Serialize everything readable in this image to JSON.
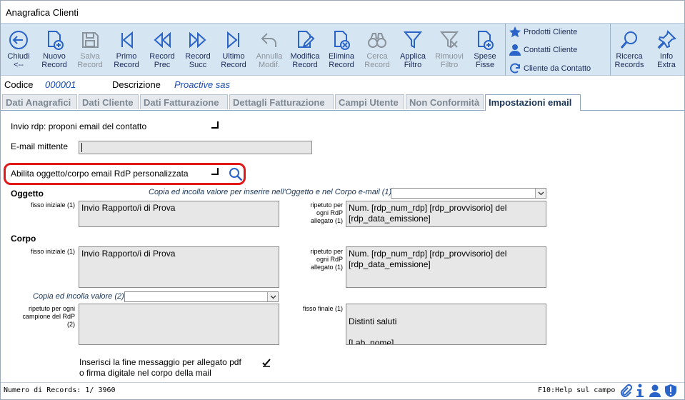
{
  "window": {
    "title": "Anagrafica Clienti"
  },
  "toolbar": {
    "buttons": [
      {
        "line1": "Chiudi",
        "line2": "<--",
        "icon": "close-arrow-icon",
        "enabled": true
      },
      {
        "line1": "Nuovo",
        "line2": "Record",
        "icon": "new-record-icon",
        "enabled": true
      },
      {
        "line1": "Salva",
        "line2": "Record",
        "icon": "save-icon",
        "enabled": false
      },
      {
        "line1": "Primo",
        "line2": "Record",
        "icon": "first-record-icon",
        "enabled": true
      },
      {
        "line1": "Record",
        "line2": "Prec",
        "icon": "previous-record-icon",
        "enabled": true
      },
      {
        "line1": "Record",
        "line2": "Succ",
        "icon": "next-record-icon",
        "enabled": true
      },
      {
        "line1": "Ultimo",
        "line2": "Record",
        "icon": "last-record-icon",
        "enabled": true
      },
      {
        "line1": "Annulla",
        "line2": "Modif.",
        "icon": "undo-icon",
        "enabled": false
      },
      {
        "line1": "Modifica",
        "line2": "Record",
        "icon": "edit-record-icon",
        "enabled": true
      },
      {
        "line1": "Elimina",
        "line2": "Record",
        "icon": "delete-record-icon",
        "enabled": true
      },
      {
        "line1": "Cerca",
        "line2": "Record",
        "icon": "binoculars-icon",
        "enabled": false
      },
      {
        "line1": "Applica",
        "line2": "Filtro",
        "icon": "filter-icon",
        "enabled": true
      },
      {
        "line1": "Rimuovi",
        "line2": "Filtro",
        "icon": "remove-filter-icon",
        "enabled": false
      },
      {
        "line1": "Spese",
        "line2": "Fisse",
        "icon": "fixed-costs-icon",
        "enabled": true
      }
    ],
    "side_links": [
      {
        "label": "Prodotti Cliente",
        "icon": "star-icon"
      },
      {
        "label": "Contatti Cliente",
        "icon": "contacts-icon"
      },
      {
        "label": "Cliente da Contatto",
        "icon": "refresh-icon"
      }
    ],
    "right_buttons": [
      {
        "line1": "Ricerca",
        "line2": "Records",
        "icon": "search-icon"
      },
      {
        "line1": "Info",
        "line2": "Extra",
        "icon": "pin-icon"
      }
    ]
  },
  "header": {
    "codice_label": "Codice",
    "codice_value": "000001",
    "descrizione_label": "Descrizione",
    "descrizione_value": "Proactive sas"
  },
  "tabs": [
    {
      "label": "Dati Anagrafici",
      "active": false
    },
    {
      "label": "Dati Cliente",
      "active": false
    },
    {
      "label": "Dati Fatturazione",
      "active": false
    },
    {
      "label": "Dettagli Fatturazione",
      "active": false
    },
    {
      "label": "Campi Utente",
      "active": false
    },
    {
      "label": "Non Conformità",
      "active": false
    },
    {
      "label": "Impostazioni email",
      "active": true
    }
  ],
  "form": {
    "invio_rdp_label": "Invio rdp: proponi email del contatto",
    "email_mittente_label": "E-mail mittente",
    "email_mittente_value": "",
    "abilita_label": "Abilita oggetto/corpo email RdP personalizzata",
    "oggetto_label": "Oggetto",
    "copia_oggetto_label": "Copia ed incolla valore per inserire nell'Oggetto e nel Corpo e-mail (1)",
    "copia_oggetto_value": "",
    "oggetto_fisso_label": "fisso iniziale (1)",
    "oggetto_fisso_value": "Invio Rapporto/i di Prova",
    "oggetto_ripetuto_label": "ripetuto per ogni RdP allegato (1)",
    "oggetto_ripetuto_value": "Num. [rdp_num_rdp] [rdp_provvisorio] del [rdp_data_emissione]",
    "corpo_label": "Corpo",
    "corpo_fisso_label": "fisso iniziale (1)",
    "corpo_fisso_value": "Invio Rapporto/i di Prova",
    "corpo_ripetuto_label": "ripetuto per ogni RdP allegato (1)",
    "corpo_ripetuto_value": "Num. [rdp_num_rdp] [rdp_provvisorio] del [rdp_data_emissione]",
    "copia2_label": "Copia ed incolla valore (2)",
    "copia2_value": "",
    "ripetuto_campione_label": "ripetuto per ogni campione del RdP (2)",
    "ripetuto_campione_value": "",
    "fisso_finale_label": "fisso finale (1)",
    "fisso_finale_value": "\nDistinti saluti\n\n[Lab_nome]",
    "inserisci_label_1": "Inserisci la fine messaggio per allegato pdf",
    "inserisci_label_2": "o firma digitale nel corpo della mail",
    "inserisci_checked": true
  },
  "status": {
    "records_label": "Numero di Records: 1/ 3960",
    "help": "F10:Help sul campo"
  },
  "colors": {
    "toolbar_bg": "#d6e5f2",
    "accent_blue": "#2a64c8",
    "highlight_red": "#e01818",
    "active_tab_text": "#1a3557"
  }
}
